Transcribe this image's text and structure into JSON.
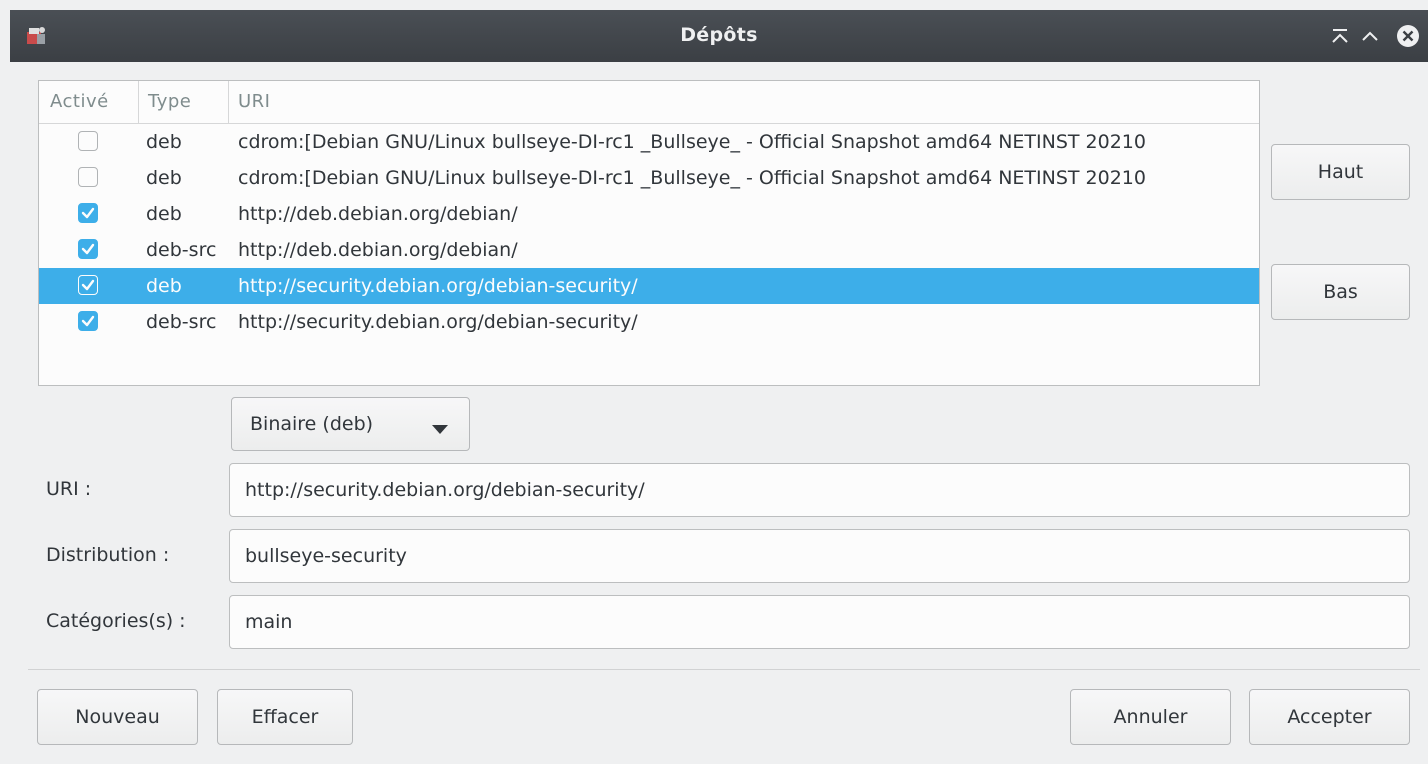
{
  "window": {
    "title": "Dépôts"
  },
  "list": {
    "headers": [
      "Activé",
      "Type",
      "URI"
    ],
    "rows": [
      {
        "enabled": false,
        "type": "deb",
        "uri": "cdrom:[Debian GNU/Linux bullseye-DI-rc1 _Bullseye_ - Official Snapshot amd64 NETINST 20210",
        "selected": false
      },
      {
        "enabled": false,
        "type": "deb",
        "uri": "cdrom:[Debian GNU/Linux bullseye-DI-rc1 _Bullseye_ - Official Snapshot amd64 NETINST 20210",
        "selected": false
      },
      {
        "enabled": true,
        "type": "deb",
        "uri": "http://deb.debian.org/debian/",
        "selected": false
      },
      {
        "enabled": true,
        "type": "deb-src",
        "uri": "http://deb.debian.org/debian/",
        "selected": false
      },
      {
        "enabled": true,
        "type": "deb",
        "uri": "http://security.debian.org/debian-security/",
        "selected": true
      },
      {
        "enabled": true,
        "type": "deb-src",
        "uri": "http://security.debian.org/debian-security/",
        "selected": false
      }
    ]
  },
  "side_buttons": {
    "up": "Haut",
    "down": "Bas"
  },
  "type_combo": {
    "selected": "Binaire (deb)"
  },
  "form": {
    "uri_label": "URI :",
    "uri_value": "http://security.debian.org/debian-security/",
    "distribution_label": "Distribution :",
    "distribution_value": "bullseye-security",
    "categories_label": "Catégories(s) :",
    "categories_value": "main"
  },
  "buttons": {
    "new": "Nouveau",
    "delete": "Effacer",
    "cancel": "Annuler",
    "accept": "Accepter"
  },
  "colors": {
    "selection": "#3daee9",
    "titlebar": "#3b3f44",
    "background": "#eff0f1"
  },
  "icons": [
    "app-icon",
    "keep-above-icon",
    "maximize-icon",
    "close-icon",
    "check-icon",
    "dropdown-arrow-icon"
  ]
}
